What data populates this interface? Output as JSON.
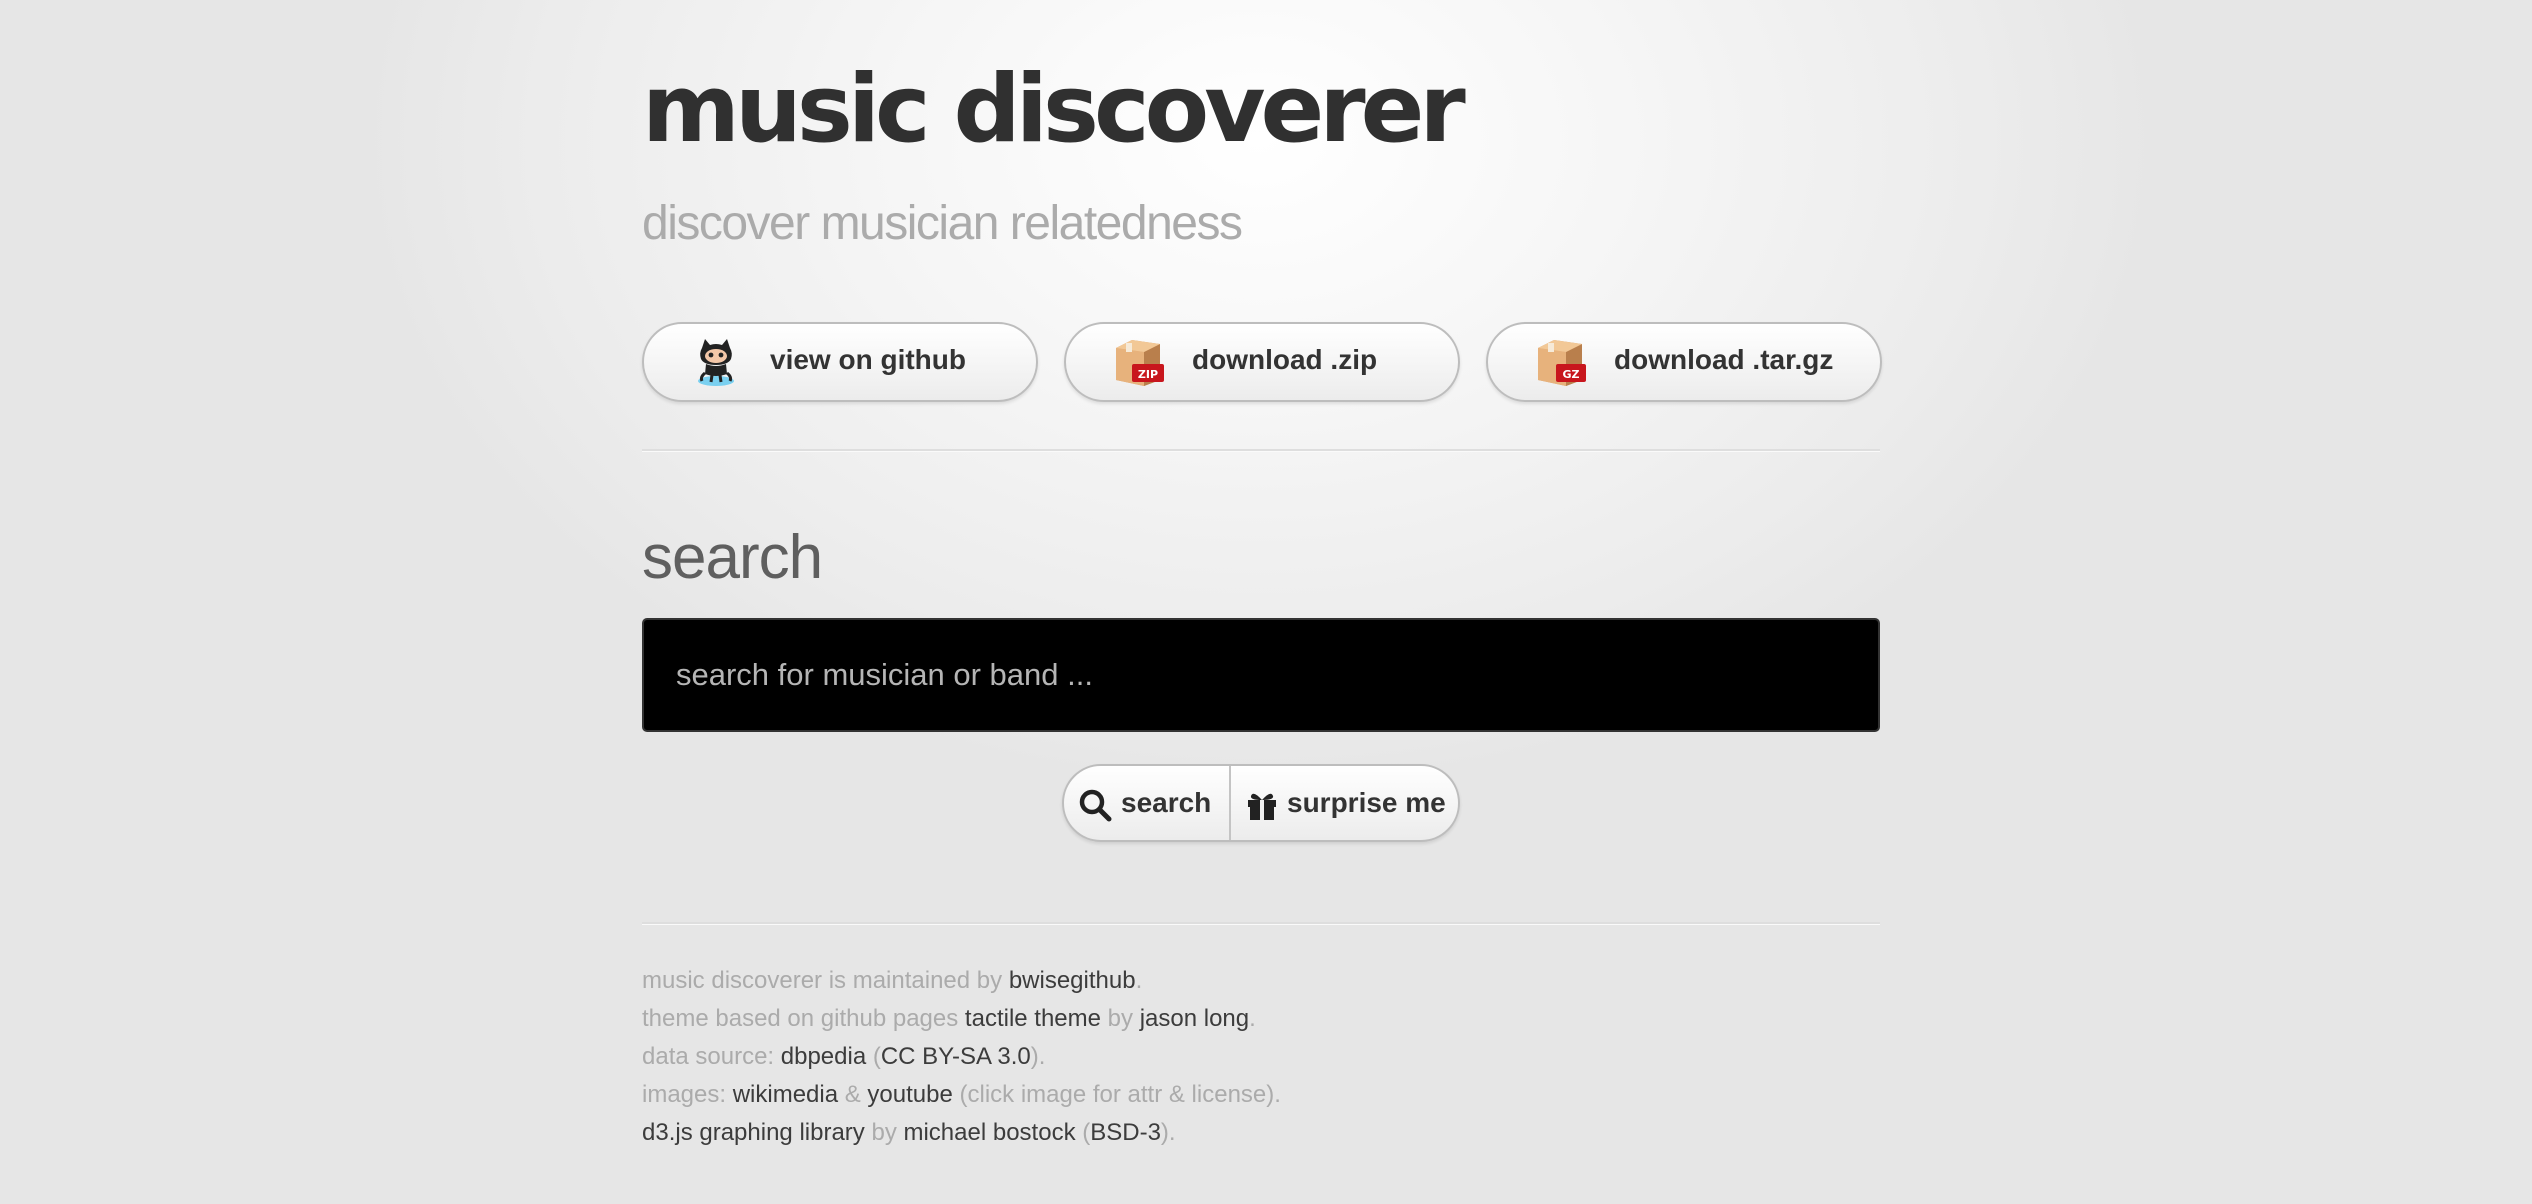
{
  "header": {
    "title": "music discoverer",
    "subtitle": "discover musician relatedness"
  },
  "download_buttons": [
    {
      "label": "view on github",
      "icon": "octocat-icon"
    },
    {
      "label": "download .zip",
      "icon": "zip-box-icon",
      "badge": "ZIP"
    },
    {
      "label": "download .tar.gz",
      "icon": "gz-box-icon",
      "badge": "GZ"
    }
  ],
  "search": {
    "heading": "search",
    "placeholder": "search for musician or band ...",
    "search_button_label": "search",
    "search_button_icon": "magnifier-icon",
    "surprise_button_label": "surprise me",
    "surprise_button_icon": "gift-icon"
  },
  "footer": {
    "line1": {
      "text1": "music discoverer is maintained by ",
      "link1": "bwisegithub",
      "text2": "."
    },
    "line2": {
      "text1": "theme based on github pages ",
      "link1": "tactile theme",
      "text2": " by ",
      "link2": "jason long",
      "text3": "."
    },
    "line3": {
      "text1": "data source: ",
      "link1": "dbpedia",
      "text2": " (",
      "link2": "CC BY-SA 3.0",
      "text3": ")."
    },
    "line4": {
      "text1": "images: ",
      "link1": "wikimedia",
      "text2": " & ",
      "link2": "youtube",
      "text3": " (click image for attr & license)."
    },
    "line5": {
      "link1": "d3.js graphing library",
      "text1": " by ",
      "link2": "michael bostock",
      "text2": " (",
      "link3": "BSD-3",
      "text3": ")."
    }
  },
  "colors": {
    "title": "#303030",
    "subtitle": "#ababab",
    "search_input_bg": "#000000",
    "footer_text": "#ababab",
    "footer_link": "#3c3c3c",
    "badge_red": "#c8161d"
  }
}
